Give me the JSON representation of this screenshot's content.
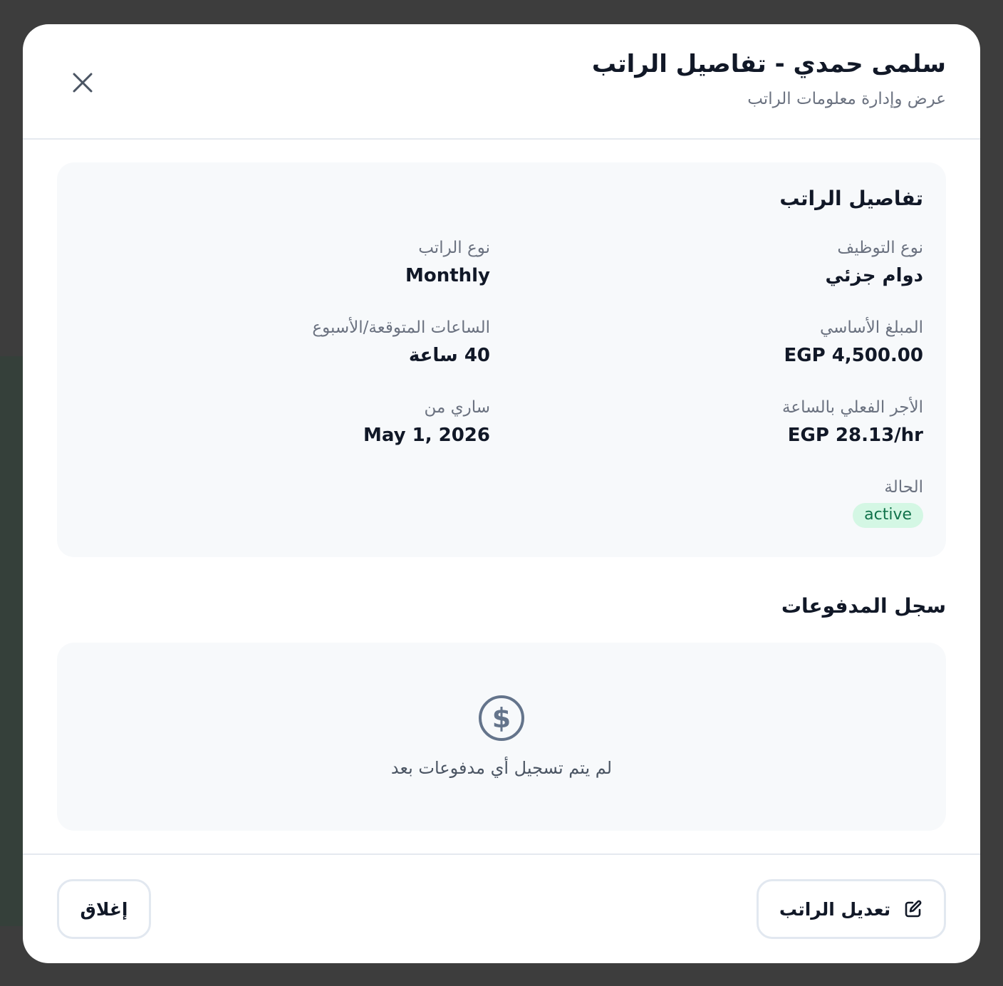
{
  "modal": {
    "title": "سلمى حمدي - تفاصيل الراتب",
    "subtitle": "عرض وإدارة معلومات الراتب",
    "close_icon": "close-icon"
  },
  "salary_details": {
    "heading": "تفاصيل الراتب",
    "employment_type": {
      "label": "نوع التوظيف",
      "value": "دوام جزئي"
    },
    "salary_type": {
      "label": "نوع الراتب",
      "value": "Monthly"
    },
    "base_amount": {
      "label": "المبلغ الأساسي",
      "value": "EGP 4,500.00"
    },
    "expected_hours": {
      "label": "الساعات المتوقعة/الأسبوع",
      "value": "40 ساعة"
    },
    "effective_hourly": {
      "label": "الأجر الفعلي بالساعة",
      "value": "EGP 28.13/hr"
    },
    "effective_from": {
      "label": "ساري من",
      "value": "May 1, 2026"
    },
    "status": {
      "label": "الحالة",
      "value": "active"
    }
  },
  "payments": {
    "heading": "سجل المدفوعات",
    "empty_icon": "dollar-circle-icon",
    "empty_text": "لم يتم تسجيل أي مدفوعات بعد"
  },
  "footer": {
    "edit_label": "تعديل الراتب",
    "edit_icon": "edit-icon",
    "close_label": "إغلاق"
  },
  "colors": {
    "status_bg": "#d4f7e4",
    "status_text": "#11724b",
    "card_bg": "#f7f9fb",
    "muted_text": "#6b7280"
  }
}
